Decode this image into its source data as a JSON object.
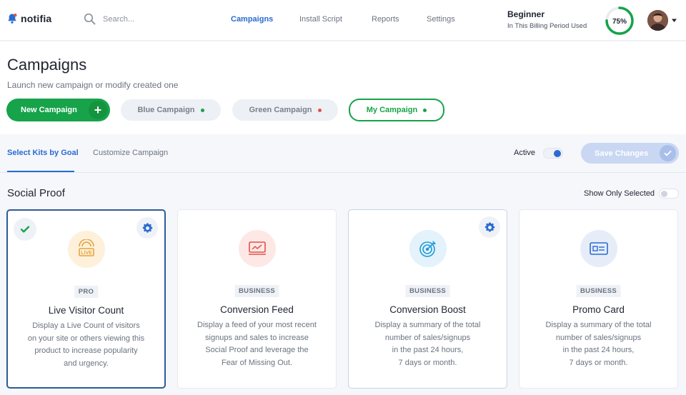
{
  "header": {
    "app_name": "notifia",
    "search_placeholder": "Search...",
    "nav": [
      {
        "label": "Campaigns",
        "active": true
      },
      {
        "label": "Install Script",
        "active": false
      },
      {
        "label": "Reports",
        "active": false
      },
      {
        "label": "Settings",
        "active": false
      }
    ],
    "plan": {
      "name": "Beginner",
      "subtitle": "In This Billing Period Used"
    },
    "usage": {
      "label": "75%",
      "value": 0.75
    },
    "colors": {
      "brand": "#2a6bd1",
      "accent": "#16a34a"
    }
  },
  "page": {
    "title": "Campaigns",
    "subtitle": "Launch new campaign or modify created one"
  },
  "campaigns": {
    "new_button": "New Campaign",
    "items": [
      {
        "label": "Blue Campaign",
        "status_color": "#16a34a"
      },
      {
        "label": "Green Campaign",
        "status_color": "#e0524a"
      },
      {
        "label": "My Campaign",
        "status_color": "#16a34a",
        "selected": true
      }
    ]
  },
  "tabs": {
    "items": [
      "Select Kits by Goal",
      "Customize Campaign"
    ],
    "active_label": "Active",
    "save_label": "Save Changes"
  },
  "section": {
    "title": "Social Proof",
    "show_only_selected": "Show Only Selected"
  },
  "cards": [
    {
      "tier": "PRO",
      "title": "Live Visitor Count",
      "description": "Display a Live Count of visitors\non your site or others viewing this\nproduct to increase popularity\nand urgency.",
      "icon": "live-badge-icon",
      "selected": true,
      "settings": true
    },
    {
      "tier": "BUSINESS",
      "title": "Conversion Feed",
      "description": "Display a feed of your most recent\nsignups and sales to increase\nSocial Proof and leverage the\nFear of Missing Out.",
      "icon": "chart-screen-icon",
      "selected": false,
      "settings": false
    },
    {
      "tier": "BUSINESS",
      "title": "Conversion Boost",
      "description": "Display a summary of the total\nnumber of sales/signups\nin the past 24 hours,\n7 days or month.",
      "icon": "target-icon",
      "selected": false,
      "settings": true
    },
    {
      "tier": "BUSINESS",
      "title": "Promo Card",
      "description": "Display a summary of the total\nnumber of sales/signups\nin the past 24 hours,\n7 days or month.",
      "icon": "card-icon",
      "selected": false,
      "settings": false
    }
  ]
}
